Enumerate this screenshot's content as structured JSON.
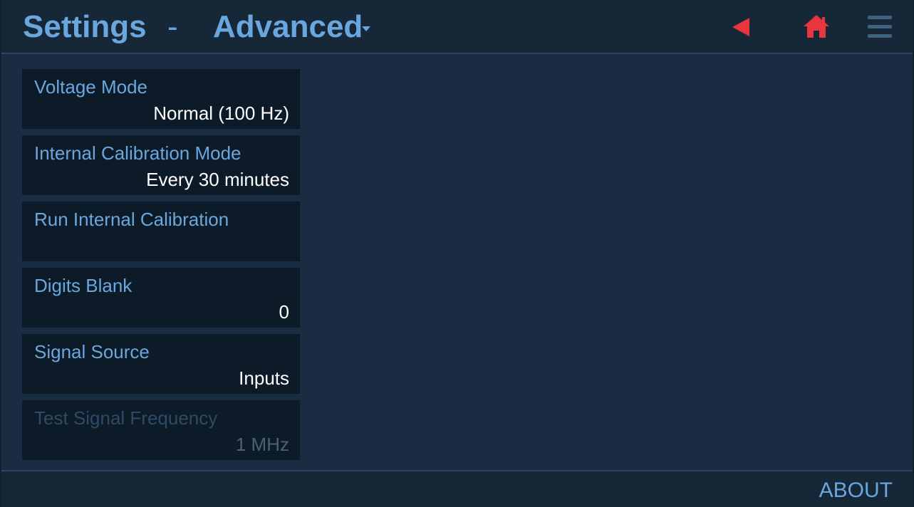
{
  "header": {
    "title": "Settings",
    "separator": "-",
    "section": "Advanced",
    "icons": {
      "dropdown": "caret-down-icon",
      "back": "back-arrow-icon",
      "home": "home-icon",
      "menu": "hamburger-menu-icon"
    }
  },
  "settings": {
    "items": [
      {
        "label": "Voltage Mode",
        "value": "Normal (100 Hz)",
        "enabled": true
      },
      {
        "label": "Internal Calibration Mode",
        "value": "Every 30 minutes",
        "enabled": true
      },
      {
        "label": "Run Internal Calibration",
        "value": "",
        "enabled": true
      },
      {
        "label": "Digits Blank",
        "value": "0",
        "enabled": true
      },
      {
        "label": "Signal Source",
        "value": "Inputs",
        "enabled": true
      },
      {
        "label": "Test Signal Frequency",
        "value": "1 MHz",
        "enabled": false
      }
    ]
  },
  "footer": {
    "about_label": "ABOUT"
  },
  "colors": {
    "background": "#1a2c42",
    "header_bg": "#162738",
    "panel_bg": "#0d1b28",
    "accent": "#6aa7de",
    "nav_red": "#e8363f",
    "value_text": "#ffffff",
    "disabled_label": "#2f4a64",
    "disabled_value": "#4a6178",
    "menu_icon": "#3d6380"
  }
}
